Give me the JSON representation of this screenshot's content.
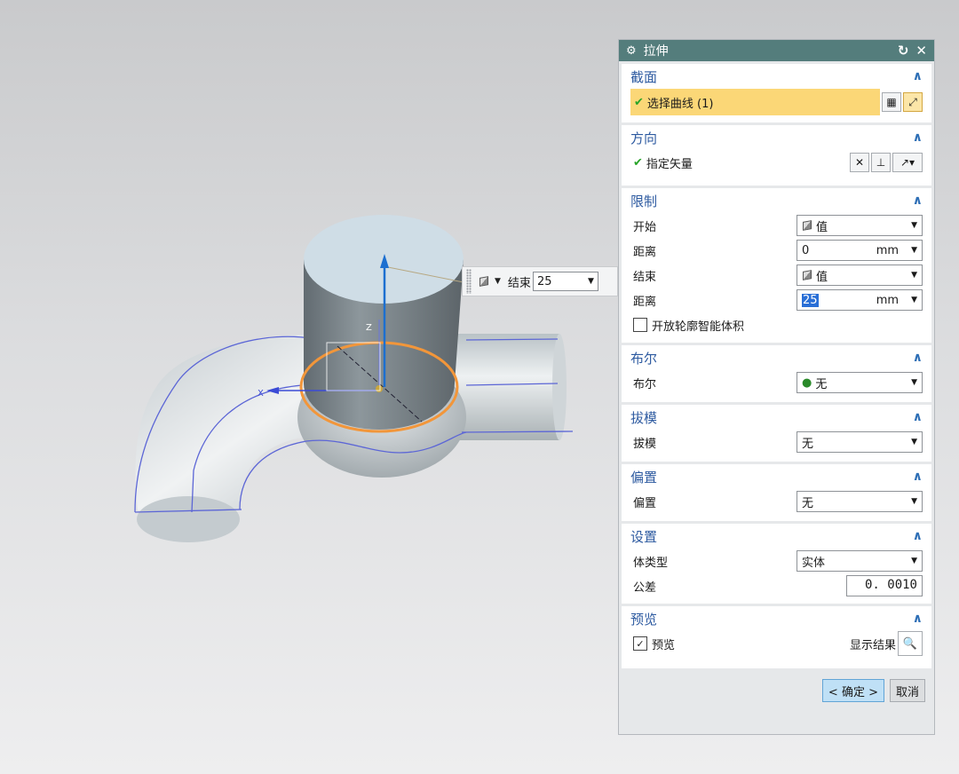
{
  "viewport": {
    "axis_x": "X",
    "axis_z": "Z"
  },
  "floating_input": {
    "label": "结束",
    "value": "25"
  },
  "dialog": {
    "title": "拉伸",
    "reset_icon": "↻",
    "close_icon": "✕",
    "sections": {
      "section": {
        "title": "截面",
        "select_curve": "选择曲线 (1)"
      },
      "direction": {
        "title": "方向",
        "vector": "指定矢量"
      },
      "limits": {
        "title": "限制",
        "start_label": "开始",
        "start_value": "值",
        "distance1_label": "距离",
        "distance1_value": "0",
        "distance1_unit": "mm",
        "end_label": "结束",
        "end_value": "值",
        "distance2_label": "距离",
        "distance2_value": "25",
        "distance2_unit": "mm",
        "open_profile": "开放轮廓智能体积"
      },
      "boolean": {
        "title": "布尔",
        "label": "布尔",
        "value": "无"
      },
      "draft": {
        "title": "拔模",
        "label": "拔模",
        "value": "无"
      },
      "offset": {
        "title": "偏置",
        "label": "偏置",
        "value": "无"
      },
      "settings": {
        "title": "设置",
        "body_type_label": "体类型",
        "body_type_value": "实体",
        "tolerance_label": "公差",
        "tolerance_value": "0. 0010"
      },
      "preview": {
        "title": "预览",
        "preview_label": "预览",
        "show_result": "显示结果"
      }
    },
    "ok_label": "< 确定 >",
    "cancel_label": "取消"
  }
}
